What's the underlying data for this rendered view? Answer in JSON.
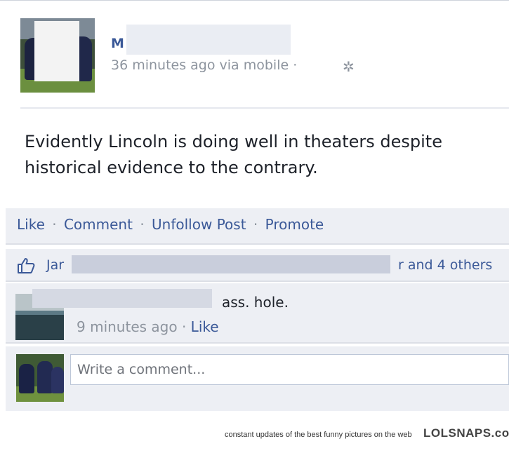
{
  "post": {
    "author_initial": "M",
    "meta": "36 minutes ago via mobile ·",
    "settings_icon": "gear-icon",
    "status_text": "Evidently Lincoln is doing well in theaters despite historical evidence to the contrary."
  },
  "actions": {
    "like": "Like",
    "comment": "Comment",
    "unfollow": "Unfollow Post",
    "promote": "Promote",
    "separator": "·"
  },
  "likes": {
    "icon": "thumbs-up-icon",
    "name_start": "Jar",
    "rest": "r and 4 others"
  },
  "comment": {
    "text": "ass. hole.",
    "time": "9 minutes ago ·",
    "like": "Like"
  },
  "composer": {
    "placeholder": "Write a comment..."
  },
  "footer": {
    "tagline": "constant updates of the best funny pictures on the web",
    "brand": "LOLSNAPS.com"
  },
  "colors": {
    "link": "#3b5998",
    "meta": "#8d949e",
    "panel": "#edeff4"
  }
}
